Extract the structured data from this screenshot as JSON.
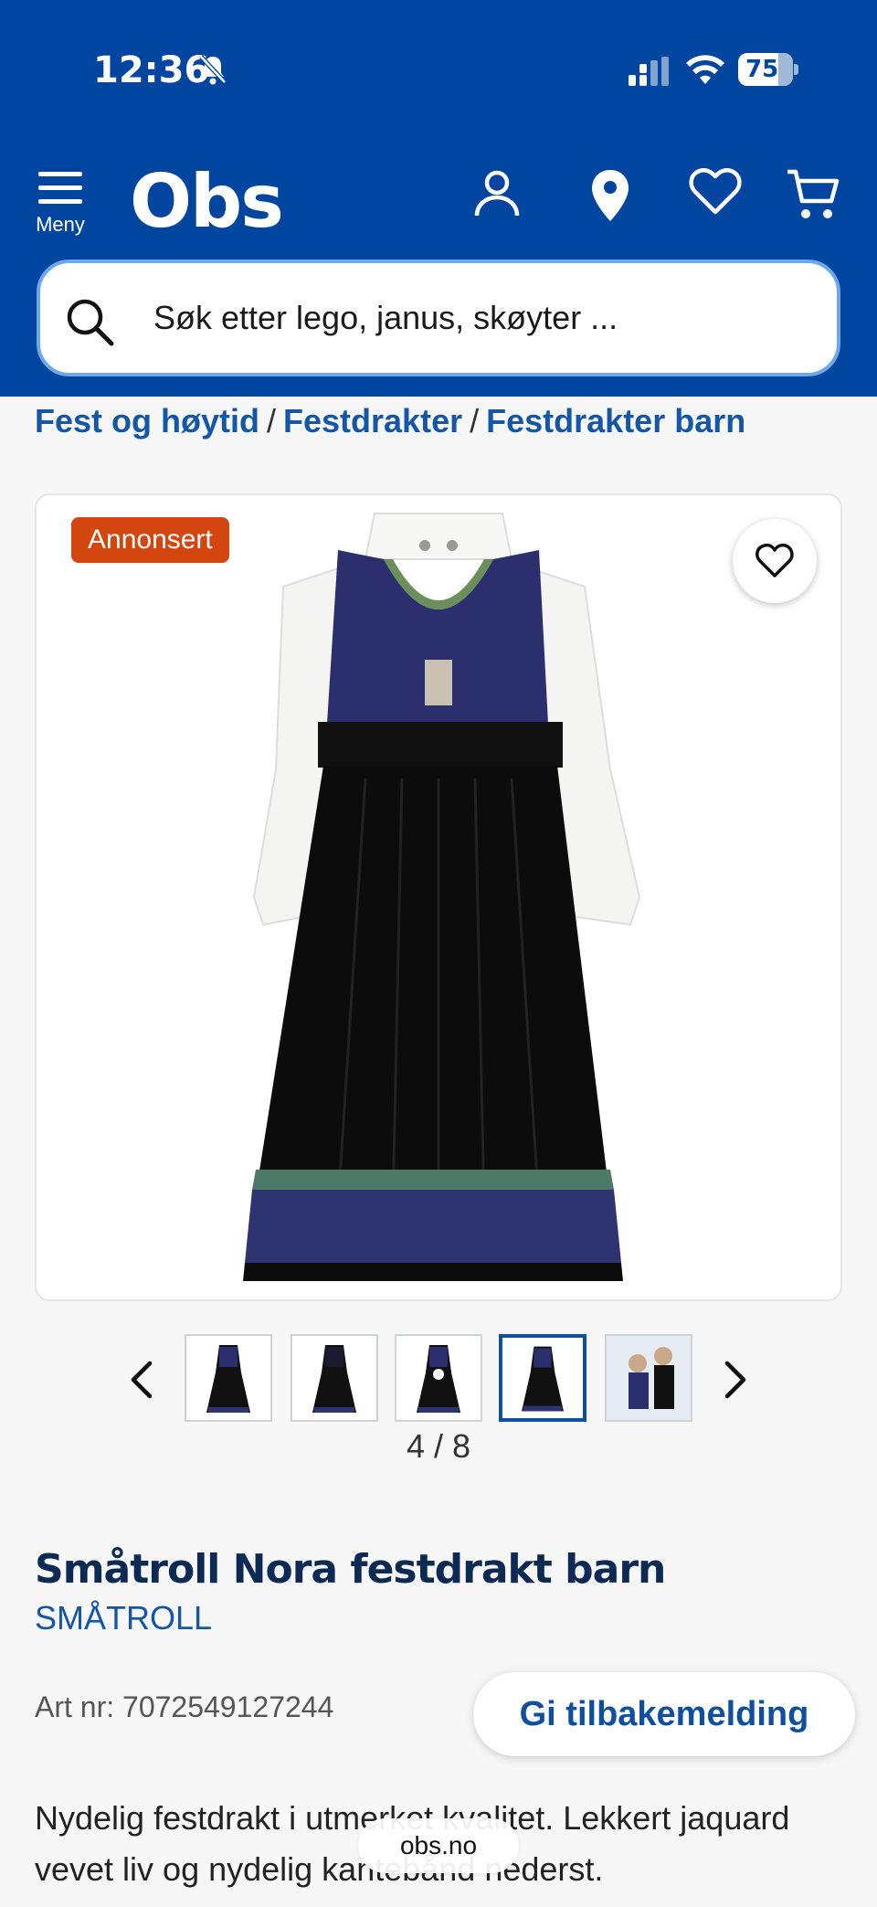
{
  "status_bar": {
    "time": "12:36",
    "battery": "75"
  },
  "header": {
    "menu_label": "Meny",
    "logo": "Obs",
    "search_placeholder": "Søk etter lego, janus, skøyter ..."
  },
  "breadcrumb": [
    "Fest og høytid",
    "Festdrakter",
    "Festdrakter barn"
  ],
  "product": {
    "badge": "Annonsert",
    "gallery_counter": "4 / 8",
    "title": "Småtroll Nora festdrakt barn",
    "brand": "SMÅTROLL",
    "art_nr": "Art nr: 7072549127244",
    "feedback_label": "Gi tilbakemelding",
    "description": "Nydelig festdrakt i utmerket kvalitet. Lekkert jaquard vevet liv og nydelig kantebånd nederst."
  },
  "browser": {
    "url": "obs.no"
  },
  "colors": {
    "brand_blue": "#0046a0",
    "badge_orange": "#d4460f",
    "link_blue": "#1457a7"
  }
}
